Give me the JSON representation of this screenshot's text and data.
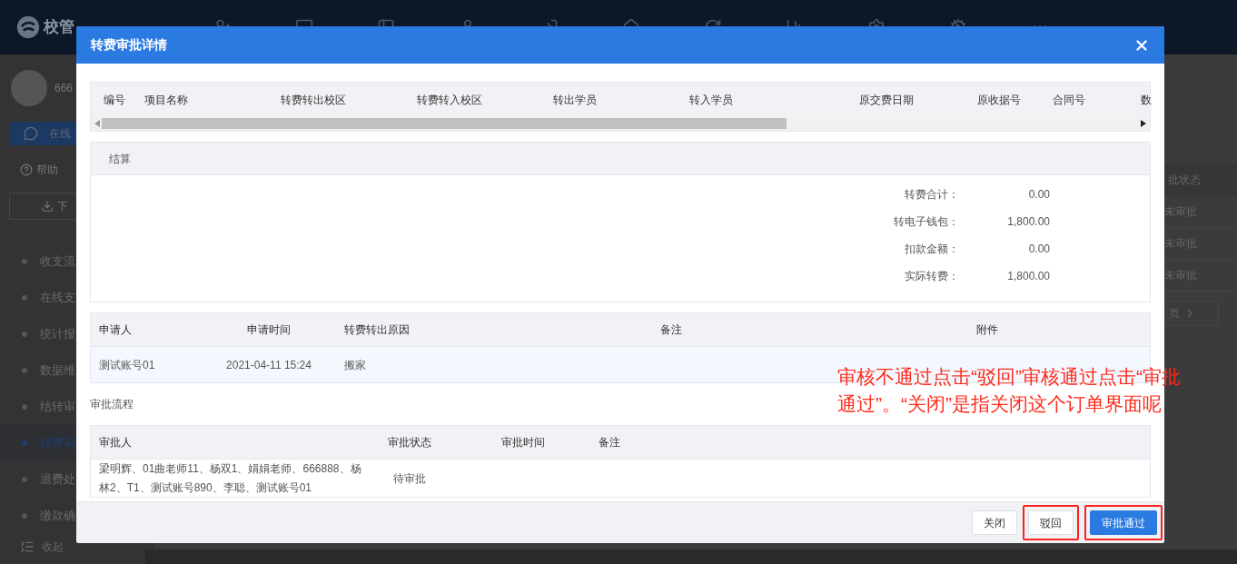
{
  "app": {
    "logo": "校管",
    "user": "666",
    "online_button": "在线",
    "help": "帮助",
    "download": "下",
    "sidebar": [
      {
        "label": "收支流",
        "selected": false
      },
      {
        "label": "在线支",
        "selected": false
      },
      {
        "label": "统计报",
        "selected": false
      },
      {
        "label": "数据维",
        "selected": false
      },
      {
        "label": "结转审",
        "selected": false
      },
      {
        "label": "转费审",
        "selected": true
      },
      {
        "label": "退费处",
        "selected": false
      },
      {
        "label": "缴款确",
        "selected": false
      }
    ],
    "collapse": "收起",
    "background_table": {
      "header": "批状态",
      "cells": [
        "未审批",
        "未审批",
        "未审批"
      ],
      "pager": "页"
    }
  },
  "dialog": {
    "title": "转费审批详情",
    "items_table": {
      "columns": [
        "编号",
        "项目名称",
        "转费转出校区",
        "转费转入校区",
        "转出学员",
        "转入学员",
        "原交费日期",
        "原收据号",
        "合同号",
        "数"
      ]
    },
    "settlement": {
      "title": "结算",
      "rows": [
        {
          "label": "转费合计：",
          "value": "0.00"
        },
        {
          "label": "转电子钱包：",
          "value": "1,800.00"
        },
        {
          "label": "扣款金额：",
          "value": "0.00"
        },
        {
          "label": "实际转费：",
          "value": "1,800.00"
        }
      ]
    },
    "applicant_table": {
      "columns": [
        "申请人",
        "申请时间",
        "转费转出原因",
        "备注",
        "附件"
      ],
      "rows": [
        {
          "applicant": "测试账号01",
          "time": "2021-04-11 15:24",
          "reason": "搬家"
        }
      ]
    },
    "approval_flow": {
      "title": "审批流程",
      "columns": [
        "审批人",
        "审批状态",
        "审批时间",
        "备注"
      ],
      "rows": [
        {
          "approvers": "梁明辉、01曲老师11、杨双1、娟娟老师、666888、杨林2、T1、测试账号890、李聪、测试账号01",
          "status": "待审批"
        }
      ]
    },
    "buttons": [
      {
        "label": "关闭",
        "kind": "default",
        "highlighted": false
      },
      {
        "label": "驳回",
        "kind": "default",
        "highlighted": true
      },
      {
        "label": "审批通过",
        "kind": "primary",
        "highlighted": true
      }
    ]
  },
  "annotation": {
    "text": "审核不通过点击“驳回”审核通过点击“审批通过”。“关闭”是指关闭这个订单界面呢"
  }
}
